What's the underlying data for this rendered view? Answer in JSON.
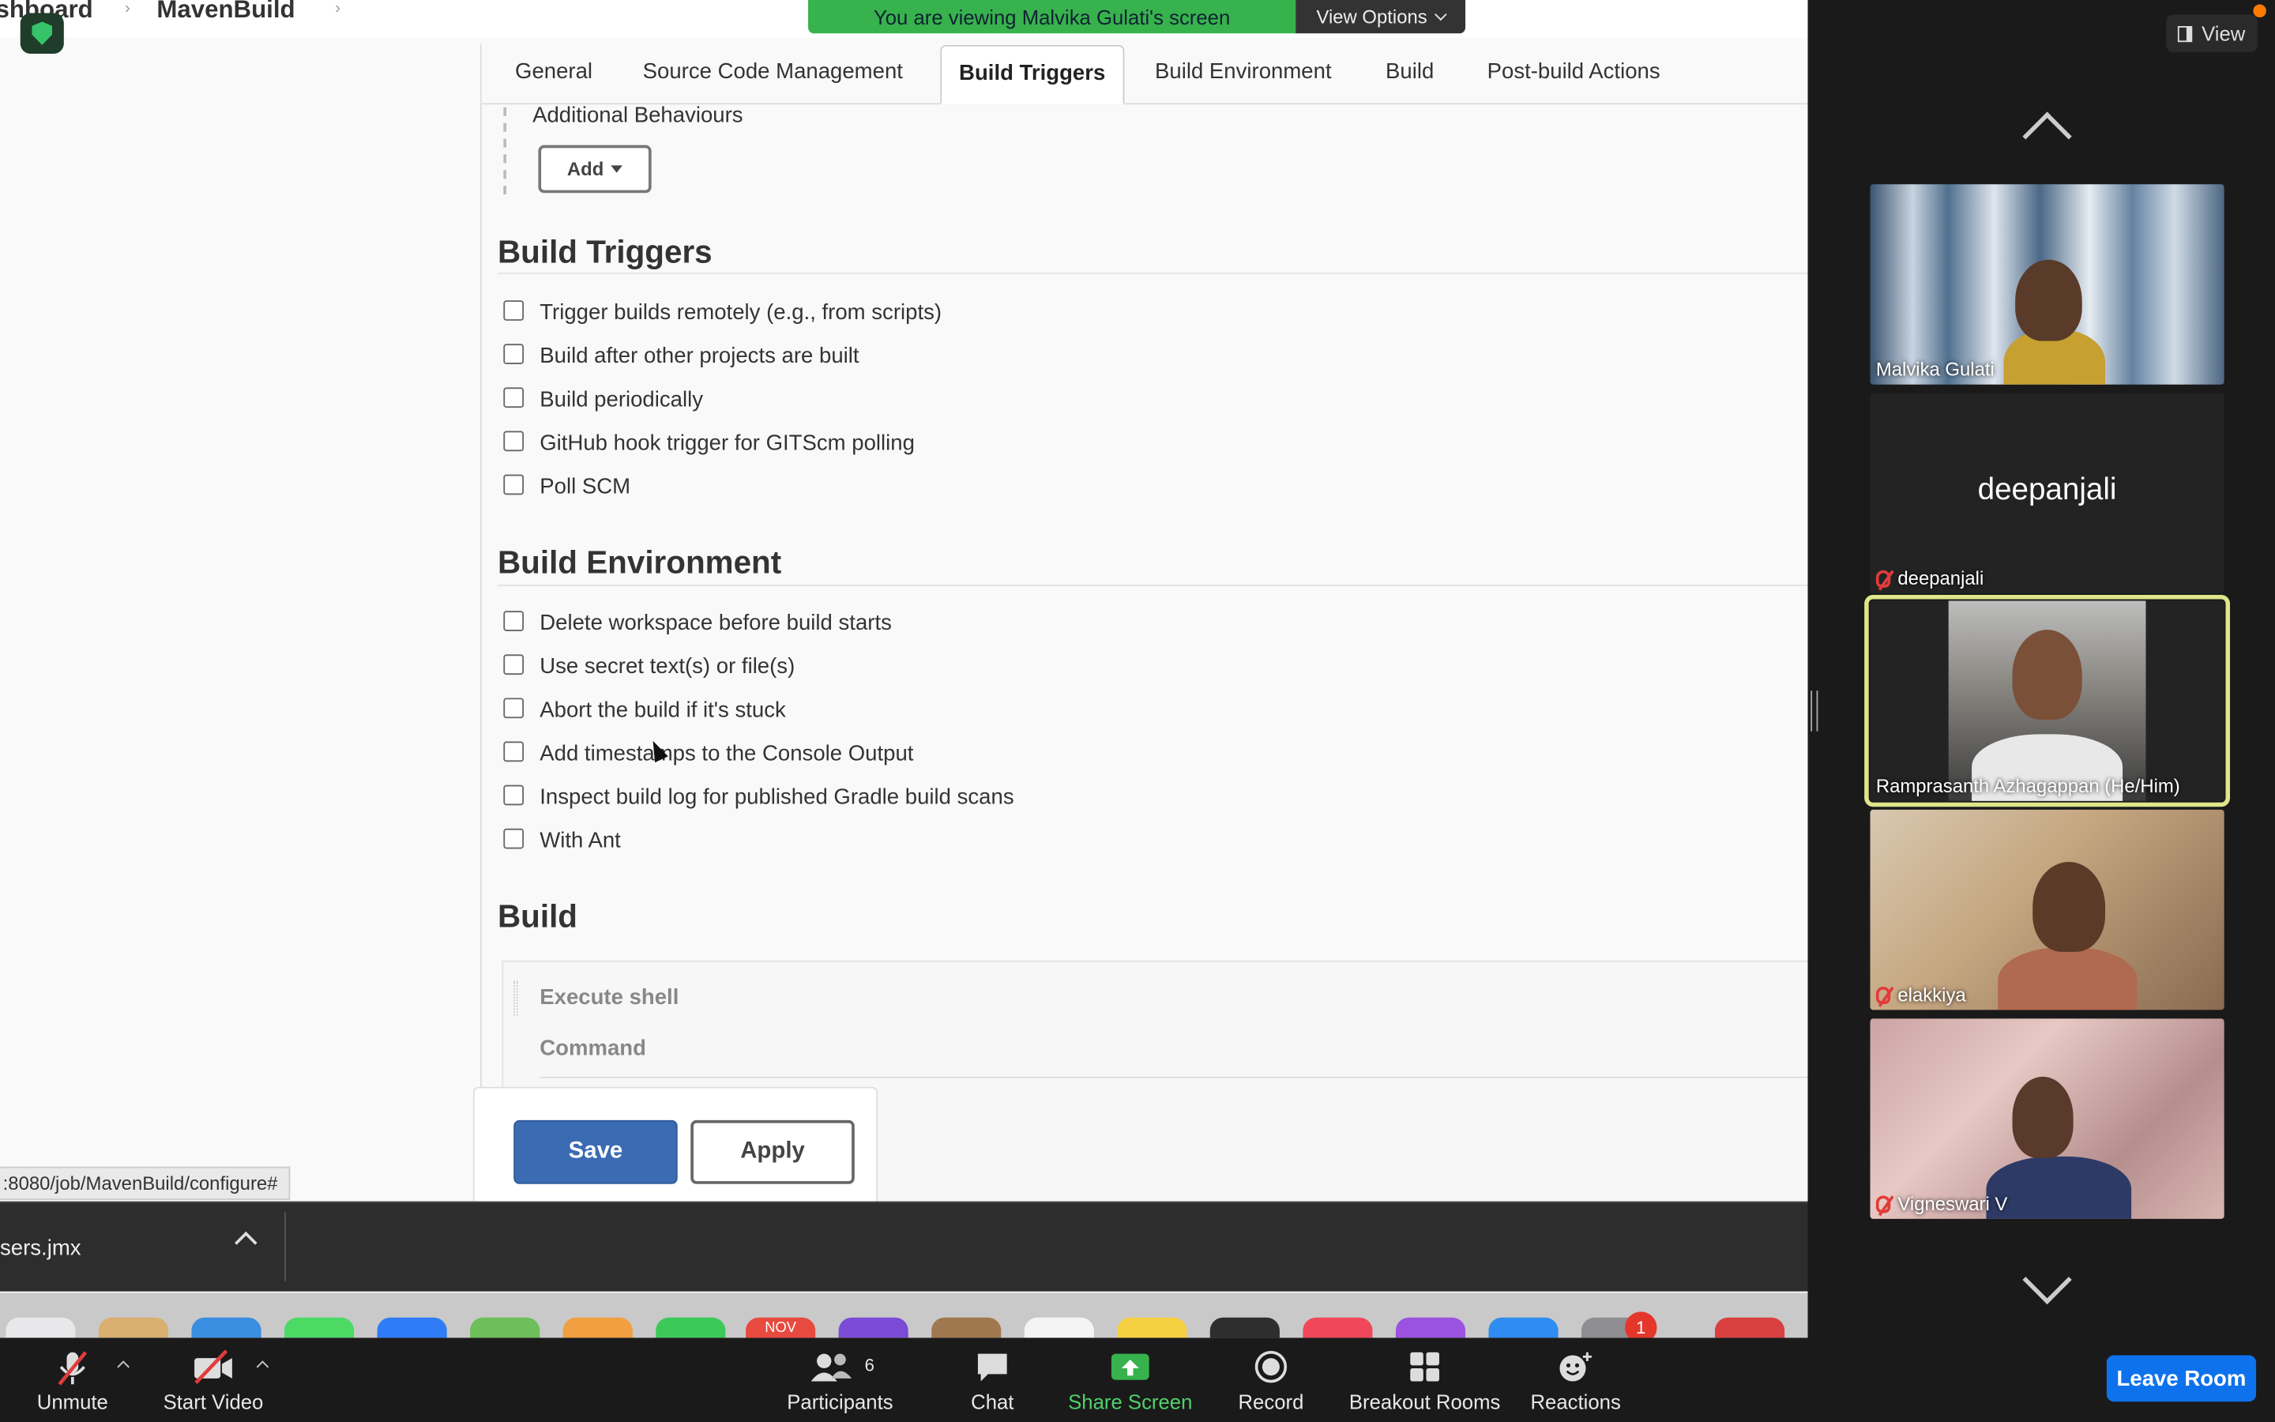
{
  "screen_share": {
    "banner_text": "You are viewing Malvika Gulati's screen",
    "view_options_label": "View Options"
  },
  "jenkins": {
    "breadcrumbs": [
      "shboard",
      "MavenBuild"
    ],
    "tabs": [
      {
        "label": "General"
      },
      {
        "label": "Source Code Management"
      },
      {
        "label": "Build Triggers",
        "active": true
      },
      {
        "label": "Build Environment"
      },
      {
        "label": "Build"
      },
      {
        "label": "Post-build Actions"
      }
    ],
    "additional_behaviours_label": "Additional Behaviours",
    "add_button_label": "Add",
    "build_triggers": {
      "title": "Build Triggers",
      "options": [
        "Trigger builds remotely (e.g., from scripts)",
        "Build after other projects are built",
        "Build periodically",
        "GitHub hook trigger for GITScm polling",
        "Poll SCM"
      ]
    },
    "build_environment": {
      "title": "Build Environment",
      "options": [
        "Delete workspace before build starts",
        "Use secret text(s) or file(s)",
        "Abort the build if it's stuck",
        "Add timestamps to the Console Output",
        "Inspect build log for published Gradle build scans",
        "With Ant"
      ]
    },
    "build": {
      "title": "Build",
      "step_title": "Execute shell",
      "command_label": "Command"
    },
    "save_label": "Save",
    "apply_label": "Apply",
    "status_url": ":8080/job/MavenBuild/configure#"
  },
  "browser": {
    "download_name": "sers.jmx"
  },
  "dock": {
    "calendar_month": "NOV",
    "badge_count": "1"
  },
  "gallery": {
    "view_label": "View",
    "participants": [
      {
        "name": "Malvika Gulati",
        "muted": false,
        "video": true
      },
      {
        "name": "deepanjali",
        "muted": true,
        "video": false
      },
      {
        "name": "Ramprasanth Azhagappan (He/Him)",
        "muted": false,
        "video": true,
        "active_speaker": true
      },
      {
        "name": "elakkiya",
        "muted": true,
        "video": true
      },
      {
        "name": "Vigneswari V",
        "muted": true,
        "video": true
      }
    ]
  },
  "controls": {
    "unmute": "Unmute",
    "start_video": "Start Video",
    "participants": "Participants",
    "participant_count": "6",
    "chat": "Chat",
    "share_screen": "Share Screen",
    "record": "Record",
    "breakout_rooms": "Breakout Rooms",
    "reactions": "Reactions",
    "leave_room": "Leave Room"
  },
  "colors": {
    "share_green": "#37b24d",
    "save_blue": "#3a6bb3",
    "leave_blue": "#0e72ed",
    "active_speaker_border": "#dfe68a",
    "muted_red": "#e23b3b"
  }
}
